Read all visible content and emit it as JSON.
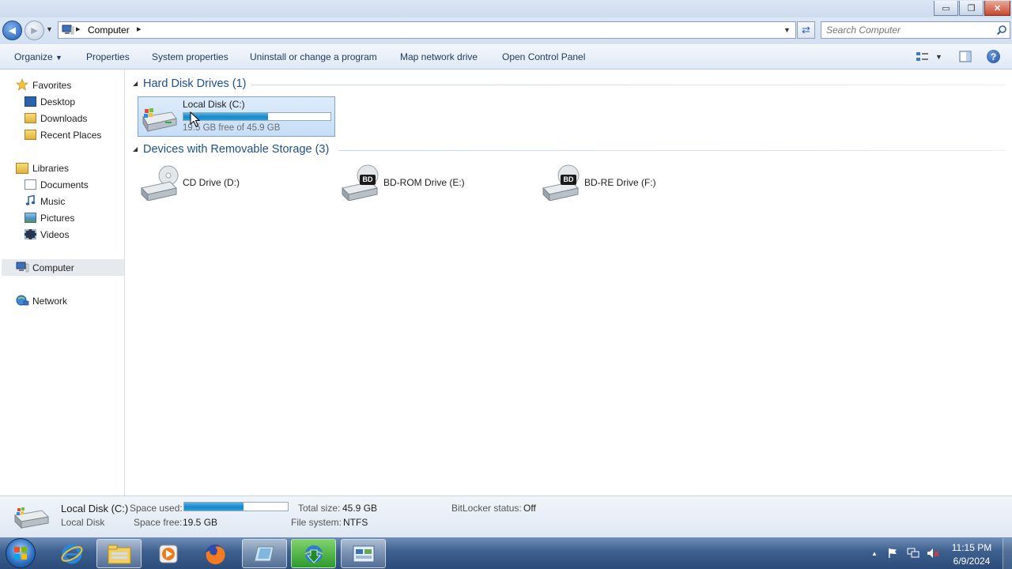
{
  "window": {
    "min_glyph": "▭",
    "max_glyph": "❐",
    "close_glyph": "✕"
  },
  "address": {
    "back_glyph": "◀",
    "forward_glyph": "▶",
    "history_glyph": "▼",
    "sep1": "▸",
    "crumb": "Computer",
    "sep2": "▸",
    "dropdown_glyph": "▼",
    "refresh_glyph": "⇄",
    "search_placeholder": "Search Computer"
  },
  "toolbar": {
    "organize": "Organize",
    "organize_arrow": "▼",
    "properties": "Properties",
    "system_properties": "System properties",
    "uninstall": "Uninstall or change a program",
    "map_drive": "Map network drive",
    "control_panel": "Open Control Panel",
    "view_arrow": "▼",
    "help": "?"
  },
  "nav": {
    "favorites": "Favorites",
    "desktop": "Desktop",
    "downloads": "Downloads",
    "recent": "Recent Places",
    "libraries": "Libraries",
    "documents": "Documents",
    "music": "Music",
    "pictures": "Pictures",
    "videos": "Videos",
    "computer": "Computer",
    "network": "Network"
  },
  "groups": {
    "arrow": "◢",
    "hdd_title": "Hard Disk Drives (1)",
    "removable_title": "Devices with Removable Storage (3)"
  },
  "drives": {
    "c": {
      "label": "Local Disk (C:)",
      "caption": "19.5 GB free of 45.9 GB",
      "used_fraction": 0.575
    },
    "d": {
      "label": "CD Drive (D:)"
    },
    "e": {
      "label": "BD-ROM Drive (E:)",
      "badge": "BD"
    },
    "f": {
      "label": "BD-RE Drive (F:)",
      "badge": "BD"
    }
  },
  "details": {
    "name": "Local Disk (C:)",
    "type": "Local Disk",
    "space_used_label": "Space used:",
    "space_used_fraction": 0.575,
    "space_free_label": "Space free:",
    "space_free": "19.5 GB",
    "total_size_label": "Total size:",
    "total_size": "45.9 GB",
    "fs_label": "File system:",
    "fs": "NTFS",
    "bitlocker_label": "BitLocker status:",
    "bitlocker": "Off"
  },
  "taskbar": {
    "tray_arrow": "▲",
    "time": "11:15 PM",
    "date": "6/9/2024"
  },
  "colors": {
    "accent_blue": "#1e4f91",
    "bar_fill": "#1c86c8",
    "taskbar": "#3d5f8e"
  }
}
